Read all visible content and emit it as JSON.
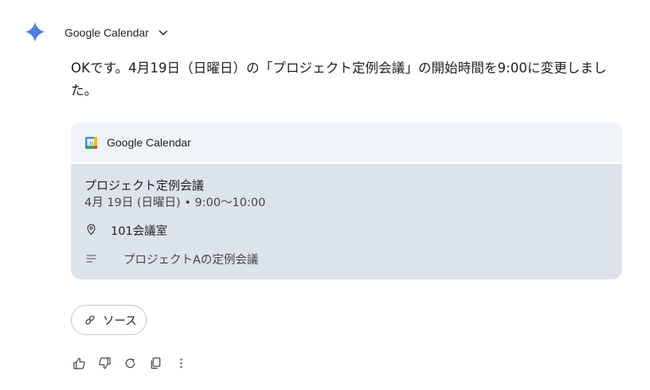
{
  "extension": {
    "name": "Google Calendar",
    "icon": "gemini-sparkle-icon",
    "toggle_icon": "chevron-down-icon"
  },
  "message": {
    "text": "OKです。4月19日（日曜日）の「プロジェクト定例会議」の開始時間を9:00に変更しました。"
  },
  "card": {
    "source_name": "Google Calendar",
    "source_icon": "google-calendar-icon",
    "event": {
      "title": "プロジェクト定例会議",
      "datetime": "4月 19日 (日曜日) • 9:00～10:00",
      "location": "101会議室",
      "location_icon": "location-pin-icon",
      "description": "プロジェクトAの定例会議",
      "description_icon": "notes-icon"
    }
  },
  "source_chip": {
    "label": "ソース",
    "icon": "link-icon"
  },
  "actions": [
    {
      "name": "thumbs-up-icon"
    },
    {
      "name": "thumbs-down-icon"
    },
    {
      "name": "regenerate-icon"
    },
    {
      "name": "copy-icon"
    },
    {
      "name": "more-vert-icon"
    }
  ],
  "colors": {
    "sparkle": "#4a7cf5",
    "card_header_bg": "#f0f4f9",
    "card_body_bg": "#dde3ea",
    "text_primary": "#1f1f1f",
    "text_secondary": "#444746",
    "chip_border": "#c4c7c5"
  }
}
